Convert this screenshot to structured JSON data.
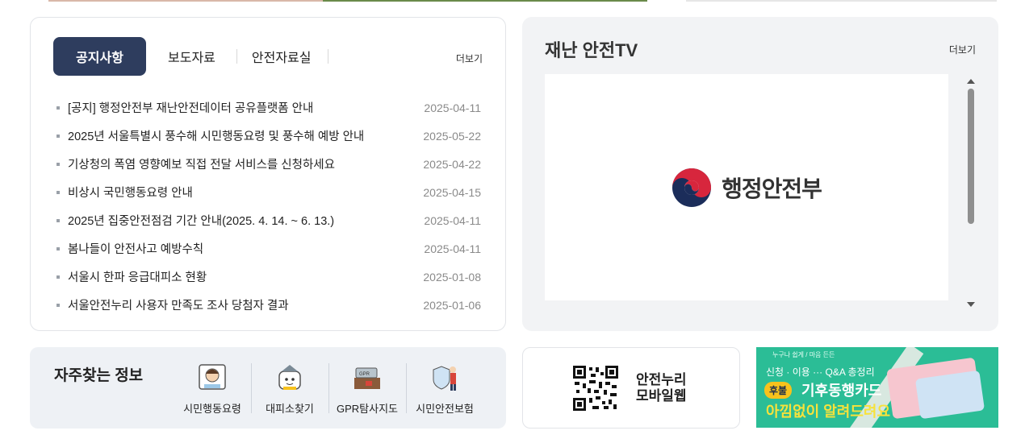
{
  "notice": {
    "tabs": [
      {
        "label": "공지사항",
        "active": true
      },
      {
        "label": "보도자료",
        "active": false
      },
      {
        "label": "안전자료실",
        "active": false
      }
    ],
    "more_label": "더보기",
    "items": [
      {
        "title": "[공지] 행정안전부 재난안전데이터 공유플랫폼 안내",
        "date": "2025-04-11"
      },
      {
        "title": "2025년 서울특별시 풍수해 시민행동요령 및 풍수해 예방 안내",
        "date": "2025-05-22"
      },
      {
        "title": "기상청의 폭염 영향예보 직접 전달 서비스를 신청하세요",
        "date": "2025-04-22"
      },
      {
        "title": "비상시 국민행동요령 안내",
        "date": "2025-04-15"
      },
      {
        "title": "2025년 집중안전점검 기간 안내(2025. 4. 14. ~ 6. 13.)",
        "date": "2025-04-11"
      },
      {
        "title": "봄나들이 안전사고 예방수칙",
        "date": "2025-04-11"
      },
      {
        "title": "서울시 한파 응급대피소 현황",
        "date": "2025-01-08"
      },
      {
        "title": "서울안전누리 사용자 만족도 조사 당첨자 결과",
        "date": "2025-01-06"
      }
    ]
  },
  "tv": {
    "title": "재난 안전TV",
    "more_label": "더보기",
    "logo_text": "행정안전부"
  },
  "freq": {
    "title": "자주찾는 정보",
    "items": [
      {
        "label": "시민행동요령",
        "icon": "citizen-guide-icon"
      },
      {
        "label": "대피소찾기",
        "icon": "shelter-finder-icon"
      },
      {
        "label": "GPR탐사지도",
        "icon": "gpr-map-icon"
      },
      {
        "label": "시민안전보험",
        "icon": "safety-insurance-icon"
      }
    ]
  },
  "mobile": {
    "line1": "안전누리",
    "line2": "모바일웹",
    "icon": "qr-code-icon"
  },
  "banner": {
    "small": "누구나 쉽게 / 마음 든든",
    "line1": "신청 · 이용 ··· Q&A 총정리",
    "badge": "후불",
    "line2": "기후동행카드",
    "line3": "아낌없이 알려드려요"
  },
  "colors": {
    "tab_active_bg": "#2e3d5e",
    "panel_gray": "#f2f3f5",
    "freq_bg": "#eef1f5",
    "banner_bg": "#2bbd96",
    "banner_yellow": "#f7e23b"
  }
}
